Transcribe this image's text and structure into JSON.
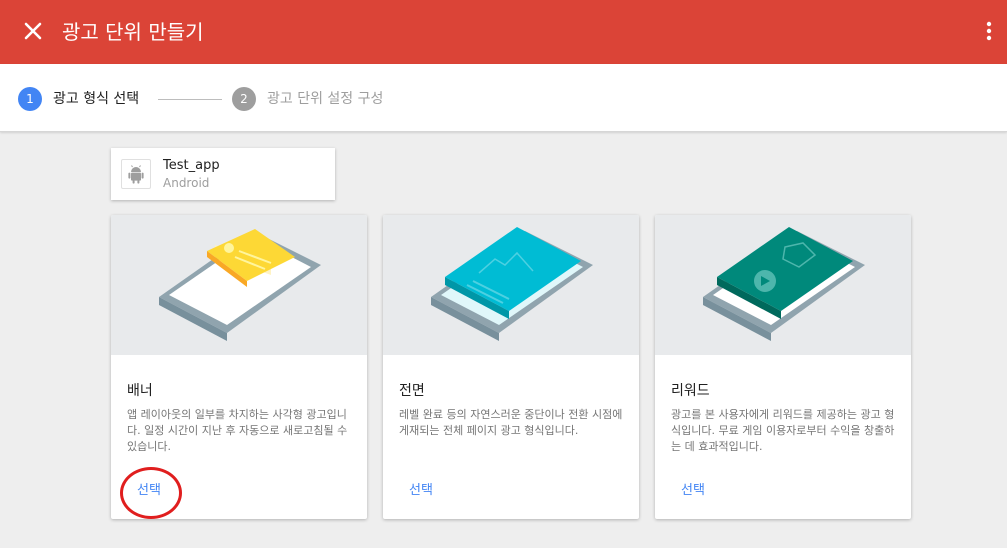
{
  "header": {
    "title": "광고 단위 만들기",
    "close_icon": "close-icon",
    "more_icon": "more-vert-icon",
    "color": "#db4437"
  },
  "stepper": {
    "steps": [
      {
        "number": "1",
        "label": "광고 형식 선택",
        "state": "active"
      },
      {
        "number": "2",
        "label": "광고 단위 설정 구성",
        "state": "inactive"
      }
    ],
    "active_color": "#4285f4"
  },
  "app": {
    "name": "Test_app",
    "platform": "Android",
    "icon": "android-icon"
  },
  "cards": [
    {
      "title": "배너",
      "description": "앱 레이아웃의 일부를 차지하는 사각형 광고입니다. 일정 시간이 지난 후 자동으로 새로고침될 수 있습니다.",
      "select_label": "선택",
      "accent": "#fbc02d"
    },
    {
      "title": "전면",
      "description": "레벨 완료 등의 자연스러운 중단이나 전환 시점에 게재되는 전체 페이지 광고 형식입니다.",
      "select_label": "선택",
      "accent": "#00acc1"
    },
    {
      "title": "리워드",
      "description": "광고를 본 사용자에게 리워드를 제공하는 광고 형식입니다. 무료 게임 이용자로부터 수익을 창출하는 데 효과적입니다.",
      "select_label": "선택",
      "accent": "#00897b"
    }
  ]
}
